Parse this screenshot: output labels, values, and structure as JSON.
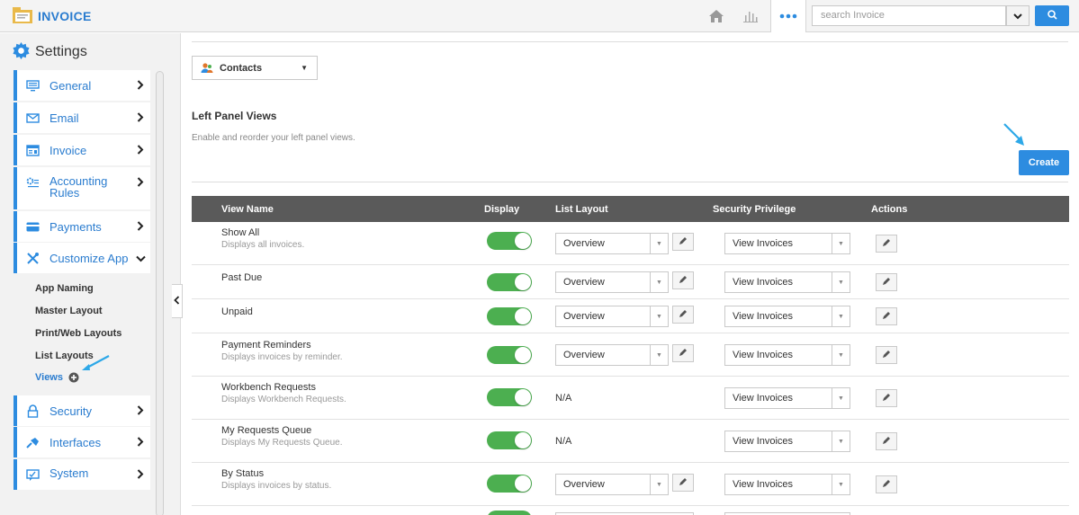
{
  "app": {
    "title": "INVOICE"
  },
  "search": {
    "placeholder": "search Invoice"
  },
  "sidebar": {
    "heading": "Settings",
    "items": [
      {
        "label": "General",
        "icon": "monitor-icon"
      },
      {
        "label": "Email",
        "icon": "envelope-icon"
      },
      {
        "label": "Invoice",
        "icon": "invoice-icon"
      },
      {
        "label": "Accounting Rules",
        "icon": "gears-icon"
      },
      {
        "label": "Payments",
        "icon": "card-icon"
      },
      {
        "label": "Customize App",
        "icon": "tools-icon"
      },
      {
        "label": "Security",
        "icon": "lock-icon"
      },
      {
        "label": "Interfaces",
        "icon": "plug-icon"
      },
      {
        "label": "System",
        "icon": "chat-icon"
      }
    ],
    "subitems": [
      "App Naming",
      "Master Layout",
      "Print/Web Layouts",
      "List Layouts",
      "Views"
    ]
  },
  "main": {
    "module_dropdown": "Contacts",
    "section_title": "Left Panel Views",
    "section_desc": "Enable and reorder your left panel views.",
    "create_label": "Create",
    "columns": [
      "View Name",
      "Display",
      "List Layout",
      "Security Privilege",
      "Actions"
    ],
    "rows": [
      {
        "name": "Show All",
        "desc": "Displays all invoices.",
        "layout": "Overview",
        "privilege": "View Invoices"
      },
      {
        "name": "Past Due",
        "desc": "",
        "layout": "Overview",
        "privilege": "View Invoices"
      },
      {
        "name": "Unpaid",
        "desc": "",
        "layout": "Overview",
        "privilege": "View Invoices"
      },
      {
        "name": "Payment Reminders",
        "desc": "Displays invoices by reminder.",
        "layout": "Overview",
        "privilege": "View Invoices"
      },
      {
        "name": "Workbench Requests",
        "desc": "Displays Workbench Requests.",
        "layout": "N/A",
        "privilege": "View Invoices"
      },
      {
        "name": "My Requests Queue",
        "desc": "Displays My Requests Queue.",
        "layout": "N/A",
        "privilege": "View Invoices"
      },
      {
        "name": "By Status",
        "desc": "Displays invoices by status.",
        "layout": "Overview",
        "privilege": "View Invoices"
      }
    ]
  },
  "colors": {
    "accent": "#2d8ce0",
    "toggle_on": "#4caf50",
    "header_bg": "#5a5a5a"
  }
}
